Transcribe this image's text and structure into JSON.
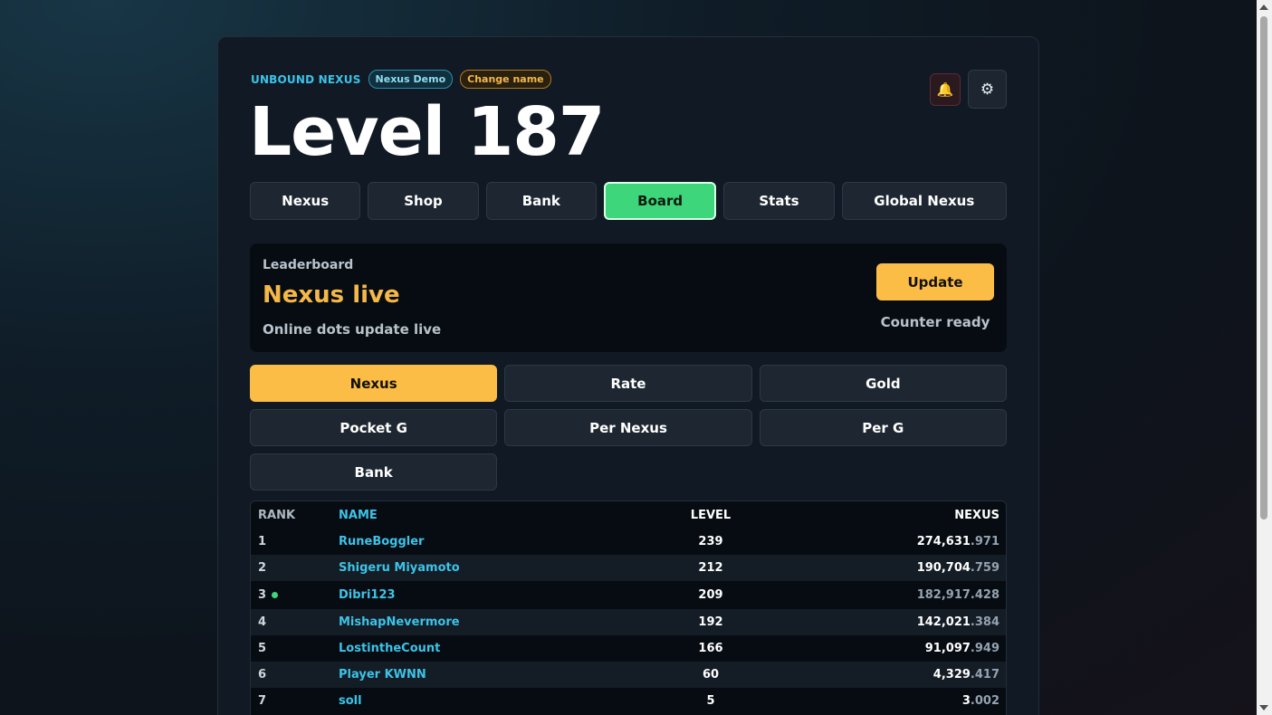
{
  "header": {
    "brand": "UNBOUND NEXUS",
    "demo_pill": "Nexus Demo",
    "change_name": "Change name",
    "bell_icon": "bell-icon",
    "gear_icon": "gear-icon"
  },
  "level_title": "Level 187",
  "tabs": [
    {
      "label": "Nexus"
    },
    {
      "label": "Shop"
    },
    {
      "label": "Bank"
    },
    {
      "label": "Board",
      "active": true
    },
    {
      "label": "Stats"
    },
    {
      "label": "Global Nexus"
    }
  ],
  "leaderboard": {
    "label": "Leaderboard",
    "headline": "Nexus live",
    "sub": "Online dots update live",
    "update_label": "Update",
    "counter": "Counter ready"
  },
  "metrics": [
    {
      "label": "Nexus",
      "active": true
    },
    {
      "label": "Rate"
    },
    {
      "label": "Gold"
    },
    {
      "label": "Pocket G"
    },
    {
      "label": "Per Nexus"
    },
    {
      "label": "Per G"
    },
    {
      "label": "Bank"
    }
  ],
  "table": {
    "headers": {
      "rank": "RANK",
      "name": "NAME",
      "level": "LEVEL",
      "nexus": "NEXUS"
    },
    "rows": [
      {
        "rank": "1",
        "name": "RuneBoggler",
        "level": "239",
        "nexus_int": "274,631",
        "nexus_frac": ".971"
      },
      {
        "rank": "2",
        "name": "Shigeru Miyamoto",
        "level": "212",
        "nexus_int": "190,704",
        "nexus_frac": ".759"
      },
      {
        "rank": "3",
        "name": "Dibri123",
        "level": "209",
        "nexus_int": "182,917",
        "nexus_frac": ".428",
        "online": true
      },
      {
        "rank": "4",
        "name": "MishapNevermore",
        "level": "192",
        "nexus_int": "142,021",
        "nexus_frac": ".384"
      },
      {
        "rank": "5",
        "name": "LostintheCount",
        "level": "166",
        "nexus_int": "91,097",
        "nexus_frac": ".949"
      },
      {
        "rank": "6",
        "name": "Player KWNN",
        "level": "60",
        "nexus_int": "4,329",
        "nexus_frac": ".417"
      },
      {
        "rank": "7",
        "name": "soll",
        "level": "5",
        "nexus_int": "3",
        "nexus_frac": ".002"
      }
    ]
  },
  "colors": {
    "accent_green": "#3ed67a",
    "accent_gold": "#fbbd45",
    "brand_cyan": "#3cc3e8"
  }
}
